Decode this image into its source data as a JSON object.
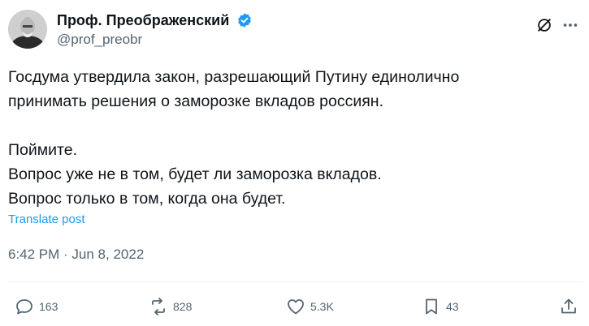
{
  "author": {
    "display_name": "Проф. Преображенский",
    "handle": "@prof_preobr"
  },
  "post": {
    "lines_para1": [
      "Госдума утвердила закон, разрешающий Путину единолично",
      "принимать решения о заморозке вкладов россиян."
    ],
    "lines_para2": [
      "Поймите.",
      "Вопрос уже не в том, будет ли заморозка вкладов.",
      "Вопрос только в том, когда она будет."
    ],
    "translate_label": "Translate post",
    "timestamp": "6:42 PM · Jun 8, 2022"
  },
  "actions": {
    "replies": "163",
    "reposts": "828",
    "likes": "5.3K",
    "bookmarks": "43"
  },
  "colors": {
    "accent": "#1d9bf0",
    "secondary_text": "#536471",
    "primary_text": "#0f1419"
  },
  "icons": [
    "verified-badge-icon",
    "grok-icon",
    "more-icon",
    "reply-icon",
    "repost-icon",
    "like-icon",
    "bookmark-icon",
    "share-icon"
  ]
}
